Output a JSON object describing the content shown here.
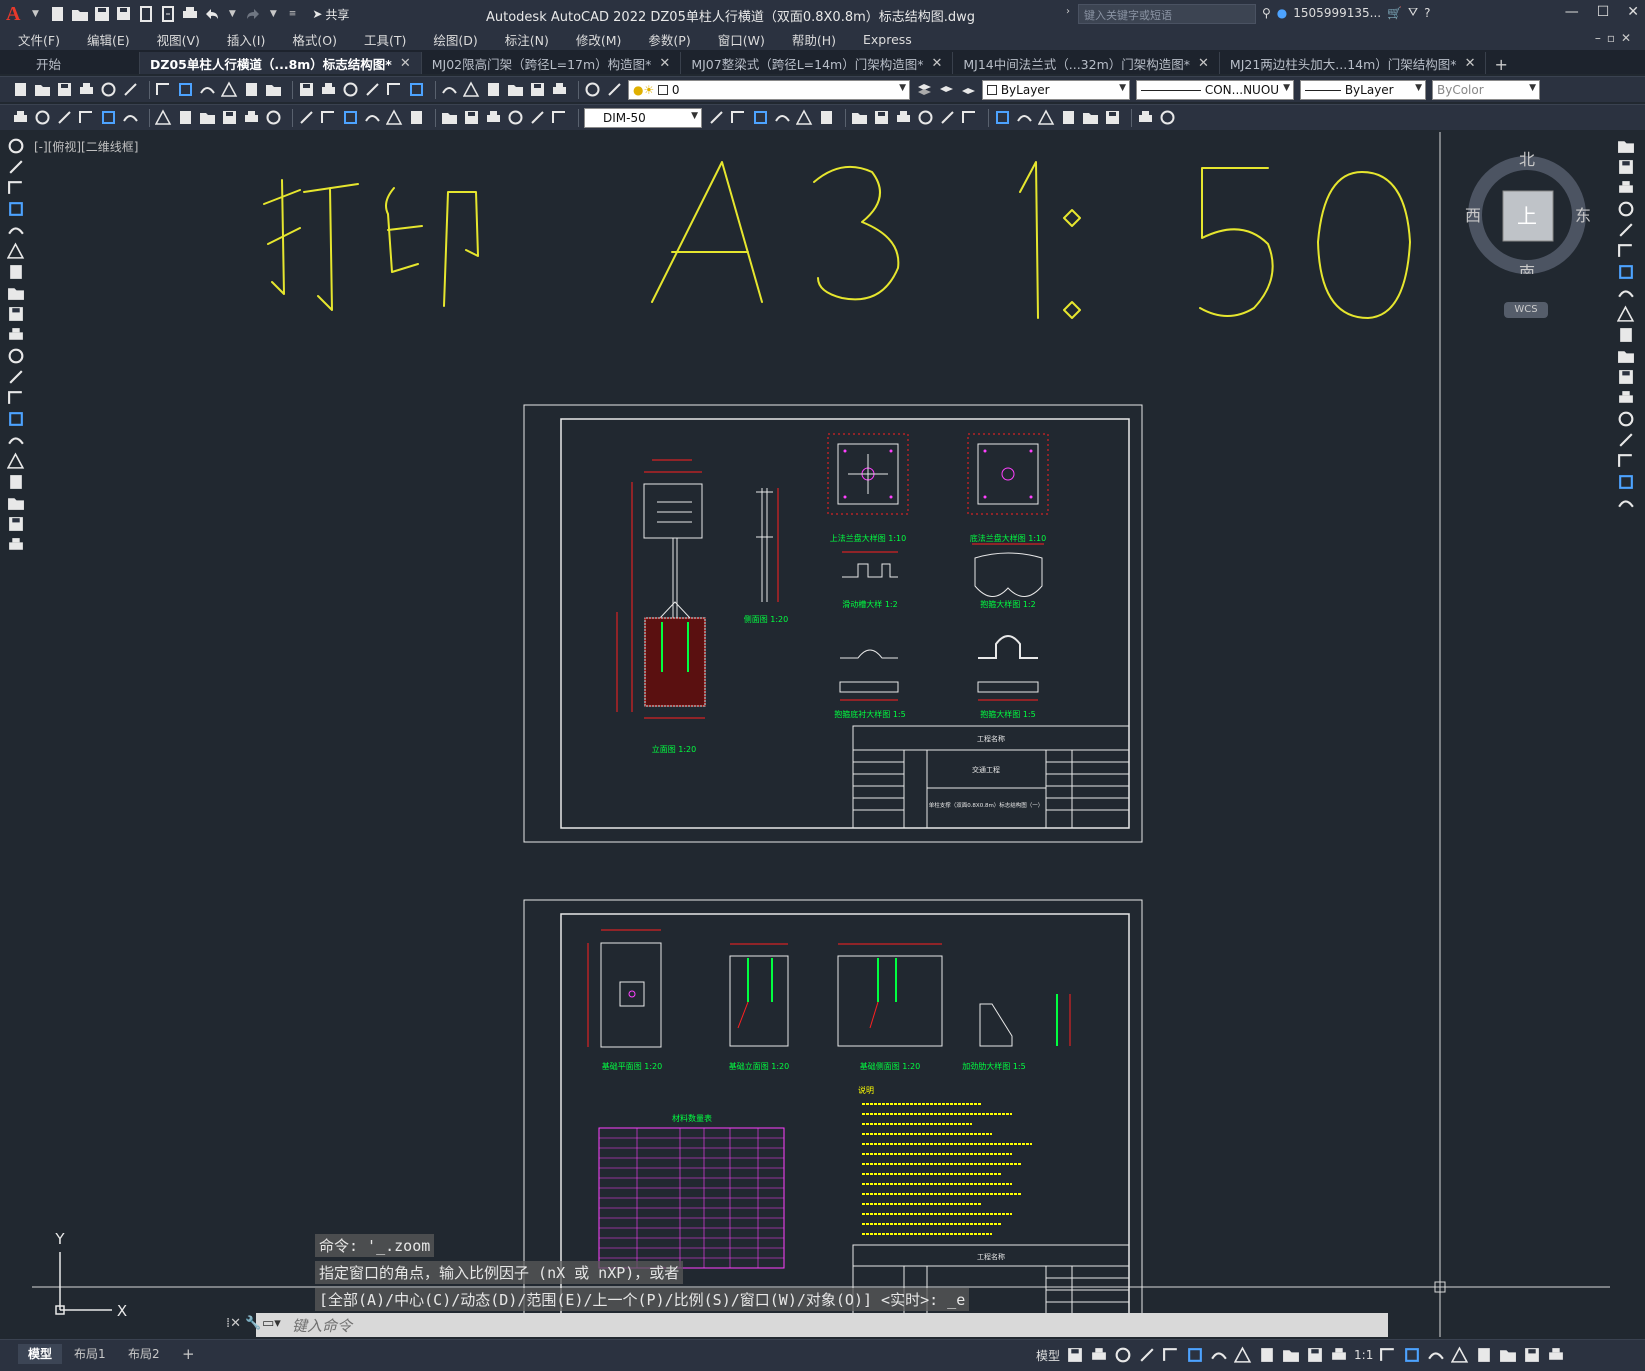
{
  "app": {
    "logo": "A",
    "share_label": "共享",
    "window_title": "Autodesk AutoCAD 2022    DZ05单柱人行横道（双面0.8X0.8m）标志结构图.dwg",
    "search_placeholder": "键入关键字或短语",
    "user_name": "1505999135..."
  },
  "menu": [
    "文件(F)",
    "编辑(E)",
    "视图(V)",
    "插入(I)",
    "格式(O)",
    "工具(T)",
    "绘图(D)",
    "标注(N)",
    "修改(M)",
    "参数(P)",
    "窗口(W)",
    "帮助(H)",
    "Express"
  ],
  "tabs": [
    {
      "label": "开始",
      "active": false
    },
    {
      "label": "DZ05单柱人行横道（...8m）标志结构图*",
      "active": true
    },
    {
      "label": "MJ02限高门架（跨径L=17m）构造图*",
      "active": false
    },
    {
      "label": "MJ07整梁式（跨径L=14m）门架构造图*",
      "active": false
    },
    {
      "label": "MJ14中间法兰式（...32m）门架构造图*",
      "active": false
    },
    {
      "label": "MJ21两边柱头加大...14m）门架结构图*",
      "active": false
    }
  ],
  "toolbar": {
    "layer_value": "0",
    "color_value": "ByLayer",
    "linetype_value": "CON...NUOU",
    "lineweight_value": "ByLayer",
    "plotstyle_value": "ByColor",
    "dimstyle_value": "DIM-50"
  },
  "canvas": {
    "viewport_label": "[-][俯视][二维线框]",
    "annotation_text": "打印 A3 1:50",
    "sheet1": {
      "caption_front": "立面图 1:20",
      "caption_side": "侧面图 1:20",
      "caption_flange_top": "上法兰盘大样图 1:10",
      "caption_flange_bottom": "底法兰盘大样图 1:10",
      "caption_slide": "滑动槽大样 1:2",
      "caption_hoop": "抱箍大样图 1:2",
      "caption_hoop_sub1": "抱箍底衬大样图 1:5",
      "caption_hoop_sub2": "抱箍大样图 1:5",
      "tb_project": "工程名称",
      "tb_subject": "交通工程",
      "tb_title": "单柱支撑（双面0.8X0.8m）标志结构图（一）"
    },
    "sheet2": {
      "caption_plan": "基础平面图 1:20",
      "caption_front": "基础立面图 1:20",
      "caption_side": "基础侧面图 1:20",
      "caption_rib": "加劲肋大样图 1:5",
      "table_title": "材料数量表",
      "notes_title": "说明",
      "tb_project": "工程名称"
    },
    "viewcube": {
      "north": "北",
      "south": "南",
      "east": "东",
      "west": "西",
      "face": "上",
      "wcs": "WCS"
    },
    "ucs_y": "Y",
    "ucs_x": "X"
  },
  "command": {
    "history": [
      "命令: '_.zoom",
      "指定窗口的角点，输入比例因子 (nX 或 nXP)，或者",
      "[全部(A)/中心(C)/动态(D)/范围(E)/上一个(P)/比例(S)/窗口(W)/对象(O)] <实时>: _e"
    ],
    "input_placeholder": "键入命令"
  },
  "status": {
    "layout_tabs": [
      "模型",
      "布局1",
      "布局2"
    ],
    "model_label": "模型",
    "scale_label": "1:1"
  },
  "colors": {
    "annotation": "#e6e62e",
    "dim": "#ffff00",
    "red": "#ff2020",
    "green": "#00ff40",
    "magenta": "#ff40ff",
    "white_line": "#e8e8e8",
    "canvas_bg": "#212830"
  }
}
